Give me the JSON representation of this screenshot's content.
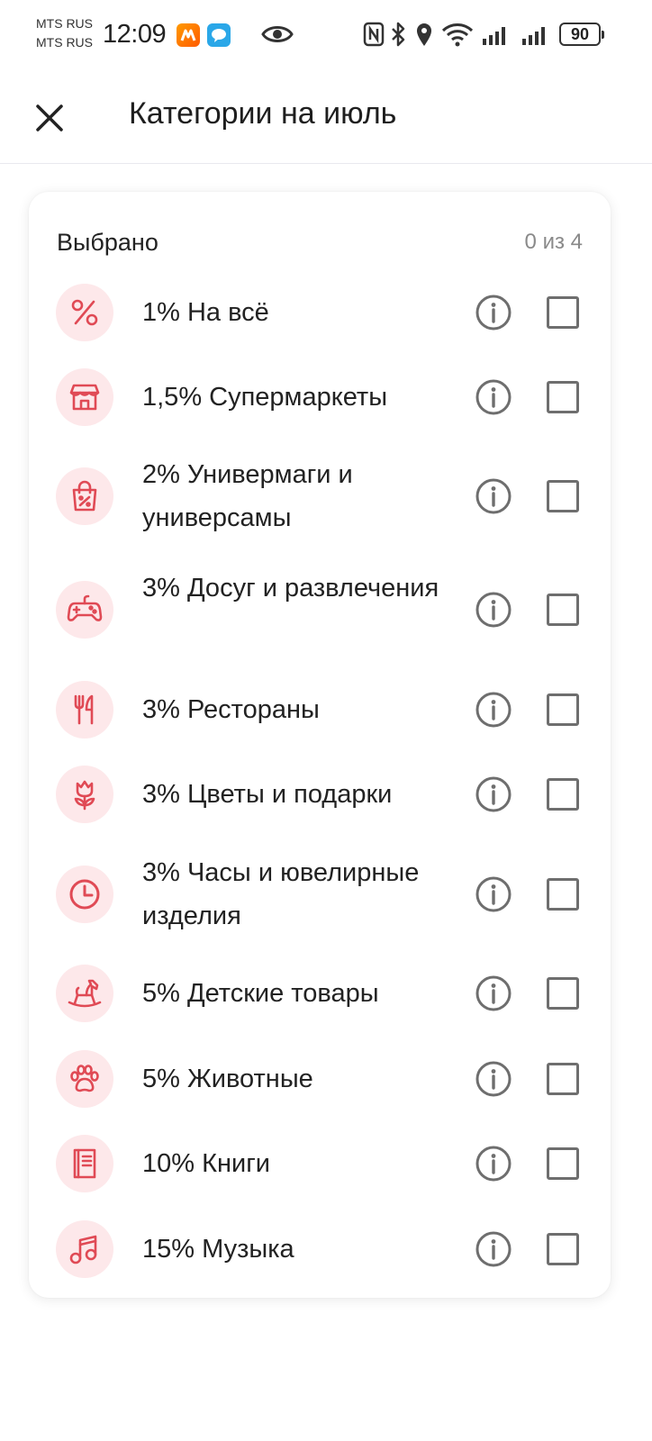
{
  "status_bar": {
    "carrier_1": "MTS RUS",
    "carrier_2": "MTS RUS",
    "time": "12:09",
    "battery": "90"
  },
  "header": {
    "title": "Категории на июль",
    "close_icon": "close-icon"
  },
  "card": {
    "selected_label": "Выбрано",
    "selected_count": "0 из 4",
    "accent_color": "#e04a55",
    "icon_bg_color": "#fde8ea",
    "categories": [
      {
        "label": "1% На всё",
        "icon": "percent-icon",
        "checked": false
      },
      {
        "label": "1,5% Супермаркеты",
        "icon": "store-icon",
        "checked": false
      },
      {
        "label": "2% Универмаги и универсамы",
        "icon": "shopping-bag-icon",
        "checked": false
      },
      {
        "label": "3% Досуг и развлечения",
        "icon": "gamepad-icon",
        "checked": false
      },
      {
        "label": "3% Рестораны",
        "icon": "fork-knife-icon",
        "checked": false
      },
      {
        "label": "3% Цветы и подарки",
        "icon": "flower-icon",
        "checked": false
      },
      {
        "label": "3% Часы и ювелирные изделия",
        "icon": "clock-icon",
        "checked": false
      },
      {
        "label": "5% Детские товары",
        "icon": "rocking-horse-icon",
        "checked": false
      },
      {
        "label": "5% Животные",
        "icon": "paw-icon",
        "checked": false
      },
      {
        "label": "10% Книги",
        "icon": "book-icon",
        "checked": false
      },
      {
        "label": "15% Музыка",
        "icon": "music-note-icon",
        "checked": false
      }
    ]
  }
}
